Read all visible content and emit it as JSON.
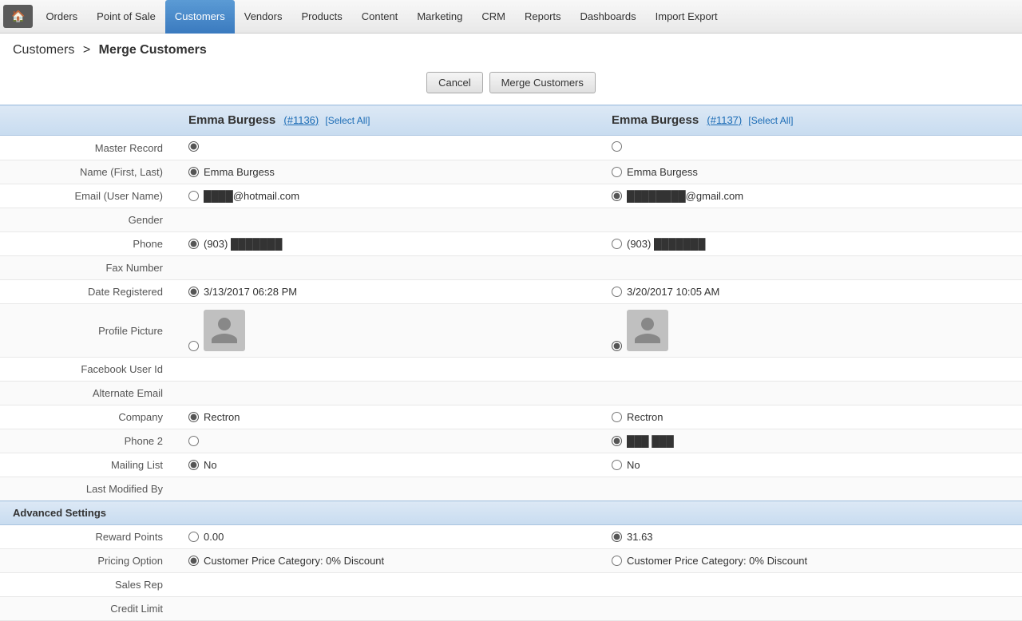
{
  "nav": {
    "home_icon": "🏠",
    "items": [
      {
        "label": "Orders",
        "active": false
      },
      {
        "label": "Point of Sale",
        "active": false
      },
      {
        "label": "Customers",
        "active": true
      },
      {
        "label": "Vendors",
        "active": false
      },
      {
        "label": "Products",
        "active": false
      },
      {
        "label": "Content",
        "active": false
      },
      {
        "label": "Marketing",
        "active": false
      },
      {
        "label": "CRM",
        "active": false
      },
      {
        "label": "Reports",
        "active": false
      },
      {
        "label": "Dashboards",
        "active": false
      },
      {
        "label": "Import Export",
        "active": false
      }
    ]
  },
  "breadcrumb": {
    "parent": "Customers",
    "separator": ">",
    "current": "Merge Customers"
  },
  "toolbar": {
    "cancel_label": "Cancel",
    "merge_label": "Merge Customers"
  },
  "columns": {
    "left": {
      "name": "Emma Burgess",
      "id": "(#1136)",
      "select_all": "[Select All]"
    },
    "right": {
      "name": "Emma Burgess",
      "id": "(#1137)",
      "select_all": "[Select All]"
    }
  },
  "rows": [
    {
      "label": "Master Record",
      "left_value": "",
      "right_value": "",
      "type": "radio_only",
      "left_checked": true,
      "right_checked": false
    },
    {
      "label": "Name (First, Last)",
      "left_value": "Emma Burgess",
      "right_value": "Emma Burgess",
      "type": "radio_text",
      "left_checked": true,
      "right_checked": false
    },
    {
      "label": "Email (User Name)",
      "left_value": "████@hotmail.com",
      "right_value": "████████@gmail.com",
      "type": "radio_text",
      "left_checked": false,
      "right_checked": true
    },
    {
      "label": "Gender",
      "left_value": "",
      "right_value": "",
      "type": "empty"
    },
    {
      "label": "Phone",
      "left_value": "(903) ███████",
      "right_value": "(903) ███████",
      "type": "radio_text",
      "left_checked": true,
      "right_checked": false
    },
    {
      "label": "Fax Number",
      "left_value": "",
      "right_value": "",
      "type": "empty"
    },
    {
      "label": "Date Registered",
      "left_value": "3/13/2017 06:28 PM",
      "right_value": "3/20/2017 10:05 AM",
      "type": "radio_text",
      "left_checked": true,
      "right_checked": false
    },
    {
      "label": "Profile Picture",
      "left_value": "",
      "right_value": "",
      "type": "profile_pic",
      "left_checked": false,
      "right_checked": true
    },
    {
      "label": "Facebook User Id",
      "left_value": "",
      "right_value": "",
      "type": "empty"
    },
    {
      "label": "Alternate Email",
      "left_value": "",
      "right_value": "",
      "type": "empty"
    },
    {
      "label": "Company",
      "left_value": "Rectron",
      "right_value": "Rectron",
      "type": "radio_text",
      "left_checked": true,
      "right_checked": false
    },
    {
      "label": "Phone 2",
      "left_value": "",
      "right_value": "███ ███",
      "type": "radio_text2",
      "left_checked": false,
      "right_checked": true
    },
    {
      "label": "Mailing List",
      "left_value": "No",
      "right_value": "No",
      "type": "radio_text",
      "left_checked": true,
      "right_checked": false
    },
    {
      "label": "Last Modified By",
      "left_value": "",
      "right_value": "",
      "type": "empty"
    }
  ],
  "advanced_rows": [
    {
      "label": "Reward Points",
      "left_value": "0.00",
      "right_value": "31.63",
      "type": "radio_text",
      "left_checked": false,
      "right_checked": true
    },
    {
      "label": "Pricing Option",
      "left_value": "Customer Price Category: 0% Discount",
      "right_value": "Customer Price Category: 0% Discount",
      "type": "radio_text",
      "left_checked": true,
      "right_checked": false
    },
    {
      "label": "Sales Rep",
      "left_value": "",
      "right_value": "",
      "type": "empty"
    },
    {
      "label": "Credit Limit",
      "left_value": "",
      "right_value": "",
      "type": "empty"
    }
  ],
  "section_label": "Advanced Settings"
}
